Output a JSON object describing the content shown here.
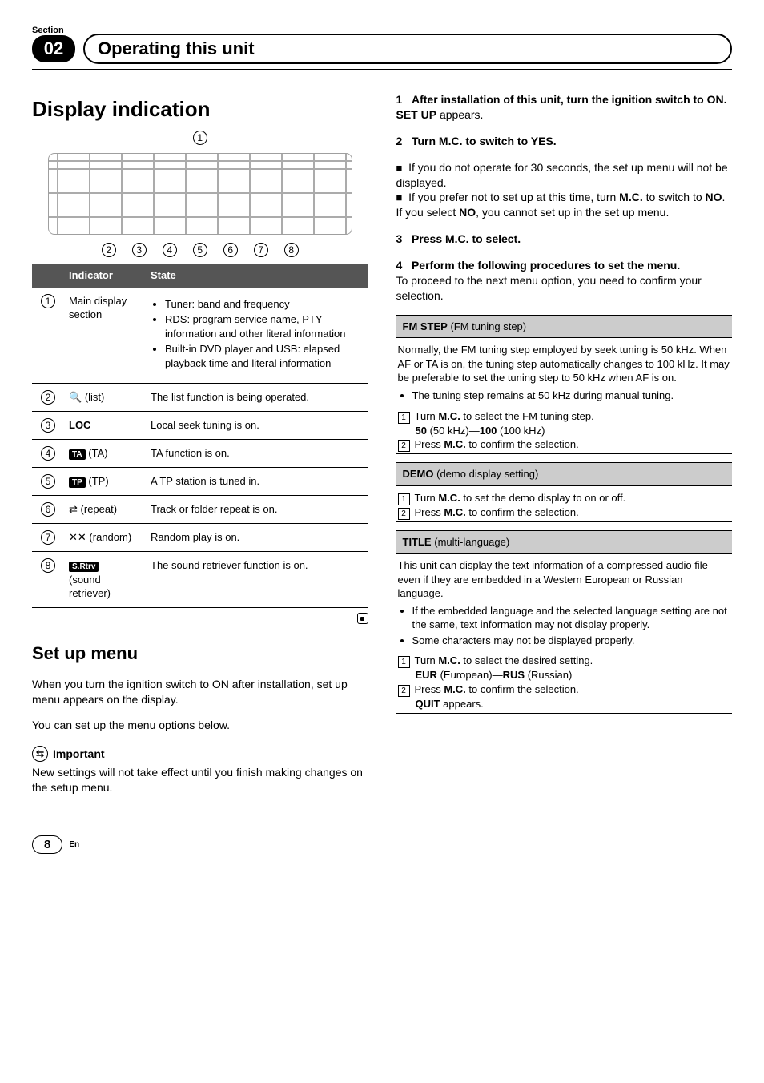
{
  "header": {
    "section_label": "Section",
    "section_num": "02",
    "chapter": "Operating this unit"
  },
  "left": {
    "h1": "Display indication",
    "diagram_callout_top": "1",
    "diagram_callouts": [
      "2",
      "3",
      "4",
      "5",
      "6",
      "7",
      "8"
    ],
    "table_headers": [
      "",
      "Indicator",
      "State"
    ],
    "rows": {
      "r1": {
        "num": "1",
        "ind": "Main display section",
        "state_bullets": [
          "Tuner: band and frequency",
          "RDS: program service name, PTY information and other literal information",
          "Built-in DVD player and USB: elapsed playback time and literal information"
        ]
      },
      "r2": {
        "num": "2",
        "ind_icon": "🔍",
        "ind_label": "(list)",
        "state": "The list function is being operated."
      },
      "r3": {
        "num": "3",
        "ind_bold": "LOC",
        "state": "Local seek tuning is on."
      },
      "r4": {
        "num": "4",
        "tag": "TA",
        "ind_label": "(TA)",
        "state": "TA function is on."
      },
      "r5": {
        "num": "5",
        "tag": "TP",
        "ind_label": "(TP)",
        "state": "A TP station is tuned in."
      },
      "r6": {
        "num": "6",
        "ind_icon": "⇄",
        "ind_label": "(repeat)",
        "state": "Track or folder repeat is on."
      },
      "r7": {
        "num": "7",
        "ind_icon": "✕✕",
        "ind_label": "(random)",
        "state": "Random play is on."
      },
      "r8": {
        "num": "8",
        "tag": "S.Rtrv",
        "ind_label": "(sound retriever)",
        "state": "The sound retriever function is on."
      }
    },
    "h2": "Set up menu",
    "para1": "When you turn the ignition switch to ON after installation, set up menu appears on the display.",
    "para2": "You can set up the menu options below.",
    "important_label": "Important",
    "important_body": "New settings will not take effect until you finish making changes on the setup menu."
  },
  "right": {
    "step1_num": "1",
    "step1_title": "After installation of this unit, turn the ignition switch to ON.",
    "step1_body_bold": "SET UP",
    "step1_body_rest": " appears.",
    "step2_num": "2",
    "step2_title": "Turn M.C. to switch to YES.",
    "step2_b1": "If you do not operate for 30 seconds, the set up menu will not be displayed.",
    "step2_b2_pre": "If you prefer not to set up at this time, turn ",
    "step2_b2_mc": "M.C.",
    "step2_b2_mid": " to switch to ",
    "step2_b2_no": "NO",
    "step2_b2_end": ".",
    "step2_after_pre": "If you select ",
    "step2_after_no": "NO",
    "step2_after_rest": ", you cannot set up in the set up menu.",
    "step3_num": "3",
    "step3_title": "Press M.C. to select.",
    "step4_num": "4",
    "step4_title": "Perform the following procedures to set the menu.",
    "step4_body": "To proceed to the next menu option, you need to confirm your selection.",
    "fm": {
      "head_bold": "FM STEP",
      "head_rest": "(FM tuning step)",
      "body": "Normally, the FM tuning step employed by seek tuning is 50 kHz. When AF or TA is on, the tuning step automatically changes to 100 kHz. It may be preferable to set the tuning step to 50 kHz when AF is on.",
      "bullet1": "The tuning step remains at 50 kHz during manual tuning.",
      "s1_pre": "Turn ",
      "s1_mc": "M.C.",
      "s1_rest": " to select the FM tuning step.",
      "opts_50b": "50",
      "opts_50p": "(50 kHz)",
      "opts_dash": "—",
      "opts_100b": "100",
      "opts_100p": "(100 kHz)",
      "s2_pre": "Press ",
      "s2_mc": "M.C.",
      "s2_rest": " to confirm the selection."
    },
    "demo": {
      "head_bold": "DEMO",
      "head_rest": "(demo display setting)",
      "s1_pre": "Turn ",
      "s1_mc": "M.C.",
      "s1_rest": " to set the demo display to on or off.",
      "s2_pre": "Press ",
      "s2_mc": "M.C.",
      "s2_rest": " to confirm the selection."
    },
    "title": {
      "head_bold": "TITLE",
      "head_rest": "(multi-language)",
      "body": "This unit can display the text information of a compressed audio file even if they are embedded in a Western European or Russian language.",
      "bullet1": "If the embedded language and the selected language setting are not the same, text information may not display properly.",
      "bullet2": "Some characters may not be displayed properly.",
      "s1_pre": "Turn ",
      "s1_mc": "M.C.",
      "s1_rest": " to select the desired setting.",
      "opts_eur_b": "EUR",
      "opts_eur_p": "(European)",
      "opts_dash": "—",
      "opts_rus_b": "RUS",
      "opts_rus_p": "(Russian)",
      "s2_pre": "Press ",
      "s2_mc": "M.C.",
      "s2_rest": " to confirm the selection.",
      "quit_b": "QUIT",
      "quit_rest": " appears."
    }
  },
  "footer": {
    "page": "8",
    "lang": "En"
  }
}
